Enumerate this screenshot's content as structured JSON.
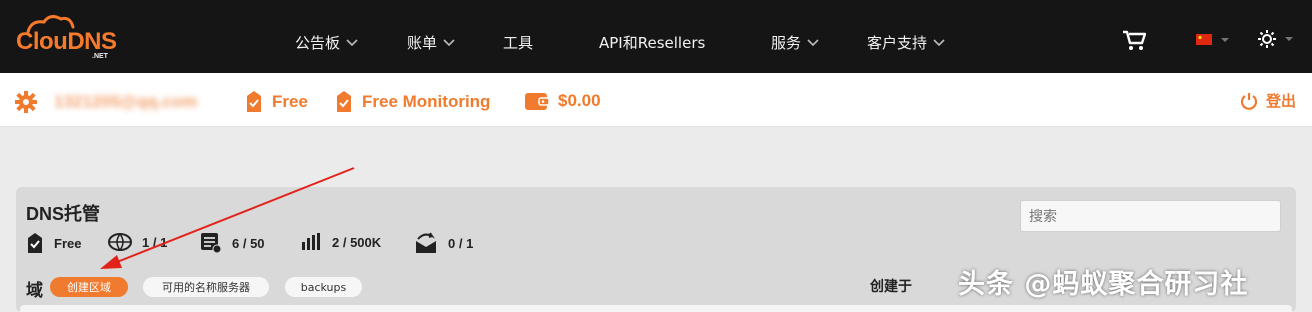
{
  "topnav": {
    "logo_text": "ClouDNS",
    "logo_sub": ".NET",
    "items": [
      {
        "label": "公告板",
        "has_dropdown": true
      },
      {
        "label": "账单",
        "has_dropdown": true
      },
      {
        "label": "工具",
        "has_dropdown": false
      },
      {
        "label": "API和Resellers",
        "has_dropdown": false
      },
      {
        "label": "服务",
        "has_dropdown": true
      },
      {
        "label": "客户支持",
        "has_dropdown": true
      }
    ],
    "cart_icon": "cart-icon",
    "language_icon": "china-flag-icon",
    "settings_icon": "sun-settings-icon"
  },
  "account": {
    "email": "1321205@qq.com",
    "plan": "Free",
    "monitoring": "Free Monitoring",
    "balance": "$0.00",
    "logout": "登出"
  },
  "panel": {
    "title": "DNS托管",
    "search_placeholder": "搜索",
    "stats": {
      "plan": "Free",
      "zones": "1 / 1",
      "records": "6 / 50",
      "queries": "2 / 500K",
      "mail_forwards": "0 / 1"
    },
    "domain_label": "域",
    "buttons": {
      "create_zone": "创建区域",
      "name_servers": "可用的名称服务器",
      "backups": "backups"
    },
    "created_label": "创建于"
  },
  "watermark": "头条 @蚂蚁聚合研习社",
  "colors": {
    "accent": "#f07a2d",
    "topbar": "#151515",
    "panel_bg": "#d9d9d9",
    "annotation_arrow": "#e2231a"
  }
}
